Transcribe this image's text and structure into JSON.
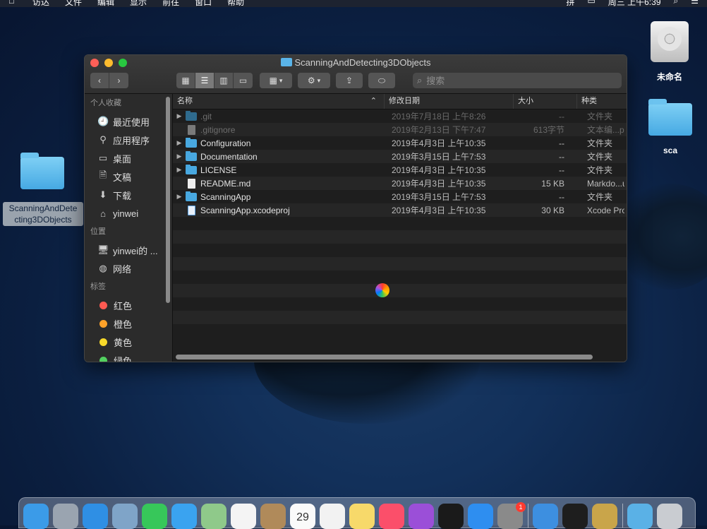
{
  "menubar": {
    "items": [
      "访达",
      "文件",
      "编辑",
      "显示",
      "前往",
      "窗口",
      "帮助"
    ],
    "input_method": "拼",
    "clock": "周三 上午6:39"
  },
  "desktop": {
    "hdd_label": "未命名",
    "folder_sca_label": "sca",
    "selected_folder_label": "ScanningAndDetecting3DObjects",
    "selected_folder_label_line1": "ScanningAndDete",
    "selected_folder_label_line2": "cting3DObjects"
  },
  "window": {
    "title": "ScanningAndDetecting3DObjects",
    "search_placeholder": "搜索",
    "sidebar": {
      "favorites_header": "个人收藏",
      "favorites": [
        {
          "label": "最近使用",
          "icon": "recents-icon"
        },
        {
          "label": "应用程序",
          "icon": "applications-icon"
        },
        {
          "label": "桌面",
          "icon": "desktop-icon"
        },
        {
          "label": "文稿",
          "icon": "documents-icon"
        },
        {
          "label": "下载",
          "icon": "downloads-icon"
        },
        {
          "label": "yinwei",
          "icon": "home-icon"
        }
      ],
      "locations_header": "位置",
      "locations": [
        {
          "label": "yinwei的 ...",
          "icon": "computer-icon"
        },
        {
          "label": "网络",
          "icon": "network-icon"
        }
      ],
      "tags_header": "标签",
      "tags": [
        {
          "label": "红色",
          "color": "#ff5a52"
        },
        {
          "label": "橙色",
          "color": "#ffa229"
        },
        {
          "label": "黄色",
          "color": "#f7d92a"
        },
        {
          "label": "绿色",
          "color": "#52d160"
        }
      ]
    },
    "columns": {
      "name": "名称",
      "date": "修改日期",
      "size": "大小",
      "kind": "种类"
    },
    "files": [
      {
        "name": ".git",
        "date": "2019年7月18日 上午8:26",
        "size": "--",
        "kind": "文件夹",
        "type": "folder",
        "hidden": true
      },
      {
        "name": ".gitignore",
        "date": "2019年2月13日 下午7:47",
        "size": "613字节",
        "kind": "文本编...p",
        "type": "doc",
        "hidden": true
      },
      {
        "name": "Configuration",
        "date": "2019年4月3日 上午10:35",
        "size": "--",
        "kind": "文件夹",
        "type": "folder",
        "hidden": false
      },
      {
        "name": "Documentation",
        "date": "2019年3月15日 上午7:53",
        "size": "--",
        "kind": "文件夹",
        "type": "folder",
        "hidden": false
      },
      {
        "name": "LICENSE",
        "date": "2019年4月3日 上午10:35",
        "size": "--",
        "kind": "文件夹",
        "type": "folder",
        "hidden": false
      },
      {
        "name": "README.md",
        "date": "2019年4月3日 上午10:35",
        "size": "15 KB",
        "kind": "Markdo...u",
        "type": "doc",
        "hidden": false
      },
      {
        "name": "ScanningApp",
        "date": "2019年3月15日 上午7:53",
        "size": "--",
        "kind": "文件夹",
        "type": "folder",
        "hidden": false
      },
      {
        "name": "ScanningApp.xcodeproj",
        "date": "2019年4月3日 上午10:35",
        "size": "30 KB",
        "kind": "Xcode Pro",
        "type": "xcode",
        "hidden": false
      }
    ]
  },
  "dock": {
    "calendar_day": "29",
    "system_prefs_badge": "1",
    "apps": [
      {
        "name": "finder-dock-icon",
        "color": "#3b9be8"
      },
      {
        "name": "launchpad-dock-icon",
        "color": "#9aa4b0"
      },
      {
        "name": "safari-dock-icon",
        "color": "#2f8fe4"
      },
      {
        "name": "preview-dock-icon",
        "color": "#7fa4c8"
      },
      {
        "name": "facetime-dock-icon",
        "color": "#37c75a"
      },
      {
        "name": "messages-dock-icon",
        "color": "#3aa3f0"
      },
      {
        "name": "maps-dock-icon",
        "color": "#8fc98a"
      },
      {
        "name": "photos-dock-icon",
        "color": "#f4f4f4"
      },
      {
        "name": "contacts-dock-icon",
        "color": "#b08a5a"
      },
      {
        "name": "calendar-dock-icon",
        "color": "#fafafa"
      },
      {
        "name": "reminders-dock-icon",
        "color": "#f2f2f2"
      },
      {
        "name": "notes-dock-icon",
        "color": "#f7d96a"
      },
      {
        "name": "music-dock-icon",
        "color": "#fb4f6a"
      },
      {
        "name": "podcasts-dock-icon",
        "color": "#9b4fd8"
      },
      {
        "name": "tv-dock-icon",
        "color": "#1a1a1a"
      },
      {
        "name": "appstore-dock-icon",
        "color": "#2e8ef0"
      },
      {
        "name": "system-preferences-dock-icon",
        "color": "#8a8a8a"
      },
      {
        "name": "xcode-dock-icon",
        "color": "#3d8fe0"
      },
      {
        "name": "terminal-dock-icon",
        "color": "#1e1e1e"
      },
      {
        "name": "keychain-dock-icon",
        "color": "#c9a54a"
      },
      {
        "name": "downloads-stack-dock-icon",
        "color": "#5ab1e6"
      },
      {
        "name": "trash-dock-icon",
        "color": "#c9ccd1"
      }
    ]
  }
}
